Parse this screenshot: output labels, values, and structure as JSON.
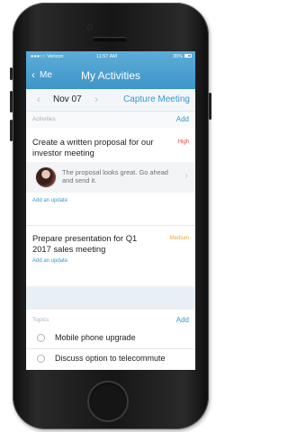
{
  "status_bar": {
    "carrier": "●●●○○ Verizon",
    "time": "11:57 AM",
    "battery": "35%"
  },
  "nav": {
    "back_label": "Me",
    "back_icon": "‹",
    "title": "My Activities"
  },
  "date_bar": {
    "prev_icon": "‹",
    "date": "Nov 07",
    "next_icon": "›",
    "action": "Capture Meeting"
  },
  "activities": {
    "label": "Activities",
    "add": "Add",
    "items": [
      {
        "title": "Create a written proposal for our investor meeting",
        "priority": "High",
        "priority_color": "#e8413a",
        "comment": "The proposal looks great. Go ahead and send it.",
        "update_link": "Add an update"
      },
      {
        "title": "Prepare presentation for Q1 2017 sales meeting",
        "priority": "Medium",
        "priority_color": "#f0a43a",
        "update_link": "Add an update"
      }
    ]
  },
  "topics": {
    "label": "Topics",
    "add": "Add",
    "items": [
      {
        "label": "Mobile phone upgrade"
      },
      {
        "label": "Discuss option to telecommute"
      }
    ]
  },
  "colors": {
    "nav_blue": "#4aa0d0",
    "link_blue": "#3a97c9"
  }
}
